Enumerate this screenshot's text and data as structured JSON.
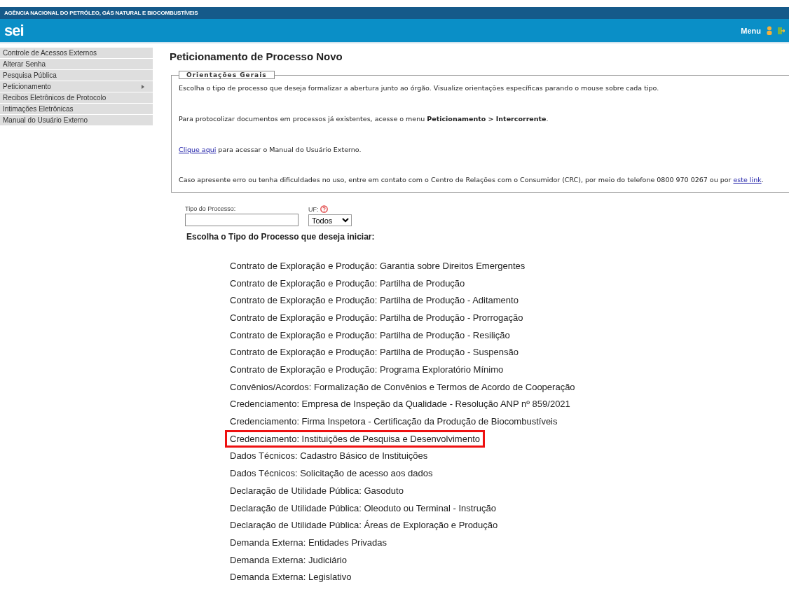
{
  "header": {
    "agency": "AGÊNCIA NACIONAL DO PETRÓLEO, GÁS NATURAL E BIOCOMBUSTÍVEIS",
    "logo": "sei",
    "menu_label": "Menu"
  },
  "sidebar": {
    "items": [
      {
        "label": "Controle de Acessos Externos",
        "has_submenu": false
      },
      {
        "label": "Alterar Senha",
        "has_submenu": false
      },
      {
        "label": "Pesquisa Pública",
        "has_submenu": false
      },
      {
        "label": "Peticionamento",
        "has_submenu": true
      },
      {
        "label": "Recibos Eletrônicos de Protocolo",
        "has_submenu": false
      },
      {
        "label": "Intimações Eletrônicas",
        "has_submenu": false
      },
      {
        "label": "Manual do Usuário Externo",
        "has_submenu": false
      }
    ]
  },
  "page_title": "Peticionamento de Processo Novo",
  "guidance": {
    "legend": "Orientações Gerais",
    "paragraphs": [
      [
        {
          "kind": "text",
          "text": "Escolha o tipo de processo que deseja formalizar a abertura junto ao órgão. Visualize orientações específicas parando o mouse sobre cada tipo."
        }
      ],
      [
        {
          "kind": "text",
          "text": "Para protocolizar documentos em processos já existentes, acesse o menu **Peticionamento > Intercorrente**."
        }
      ],
      [
        {
          "kind": "link",
          "text": "Clique aqui"
        },
        {
          "kind": "text",
          "text": " para acessar o Manual do Usuário Externo."
        }
      ],
      [
        {
          "kind": "text",
          "text": "Caso apresente erro ou tenha dificuldades no uso, entre em contato com o Centro de Relações com o Consumidor (CRC), por meio do telefone 0800 970 0267 ou por "
        },
        {
          "kind": "link",
          "text": "este link"
        },
        {
          "kind": "text",
          "text": "."
        }
      ]
    ]
  },
  "filters": {
    "type_label": "Tipo do Processo:",
    "uf_label": "UF:",
    "uf_value": "Todos"
  },
  "list_heading": "Escolha o Tipo do Processo que deseja iniciar:",
  "process_types": [
    {
      "label": "Contrato de Exploração e Produção: Garantia sobre Direitos Emergentes",
      "highlighted": false
    },
    {
      "label": "Contrato de Exploração e Produção: Partilha de Produção",
      "highlighted": false
    },
    {
      "label": "Contrato de Exploração e Produção: Partilha de Produção - Aditamento",
      "highlighted": false
    },
    {
      "label": "Contrato de Exploração e Produção: Partilha de Produção - Prorrogação",
      "highlighted": false
    },
    {
      "label": "Contrato de Exploração e Produção: Partilha de Produção - Resilição",
      "highlighted": false
    },
    {
      "label": "Contrato de Exploração e Produção: Partilha de Produção - Suspensão",
      "highlighted": false
    },
    {
      "label": "Contrato de Exploração e Produção: Programa Exploratório Mínimo",
      "highlighted": false
    },
    {
      "label": "Convênios/Acordos: Formalização de Convênios e Termos de Acordo de Cooperação",
      "highlighted": false
    },
    {
      "label": "Credenciamento: Empresa de Inspeção da Qualidade - Resolução ANP nº 859/2021",
      "highlighted": false
    },
    {
      "label": "Credenciamento: Firma Inspetora - Certificação da Produção de Biocombustíveis",
      "highlighted": false
    },
    {
      "label": "Credenciamento: Instituições de Pesquisa e Desenvolvimento",
      "highlighted": true
    },
    {
      "label": "Dados Técnicos: Cadastro Básico de Instituições",
      "highlighted": false
    },
    {
      "label": "Dados Técnicos: Solicitação de acesso aos dados",
      "highlighted": false
    },
    {
      "label": "Declaração de Utilidade Pública: Gasoduto",
      "highlighted": false
    },
    {
      "label": "Declaração de Utilidade Pública: Oleoduto ou Terminal - Instrução",
      "highlighted": false
    },
    {
      "label": "Declaração de Utilidade Pública: Áreas de Exploração e Produção",
      "highlighted": false
    },
    {
      "label": "Demanda Externa: Entidades Privadas",
      "highlighted": false
    },
    {
      "label": "Demanda Externa: Judiciário",
      "highlighted": false
    },
    {
      "label": "Demanda Externa: Legislativo",
      "highlighted": false
    }
  ]
}
